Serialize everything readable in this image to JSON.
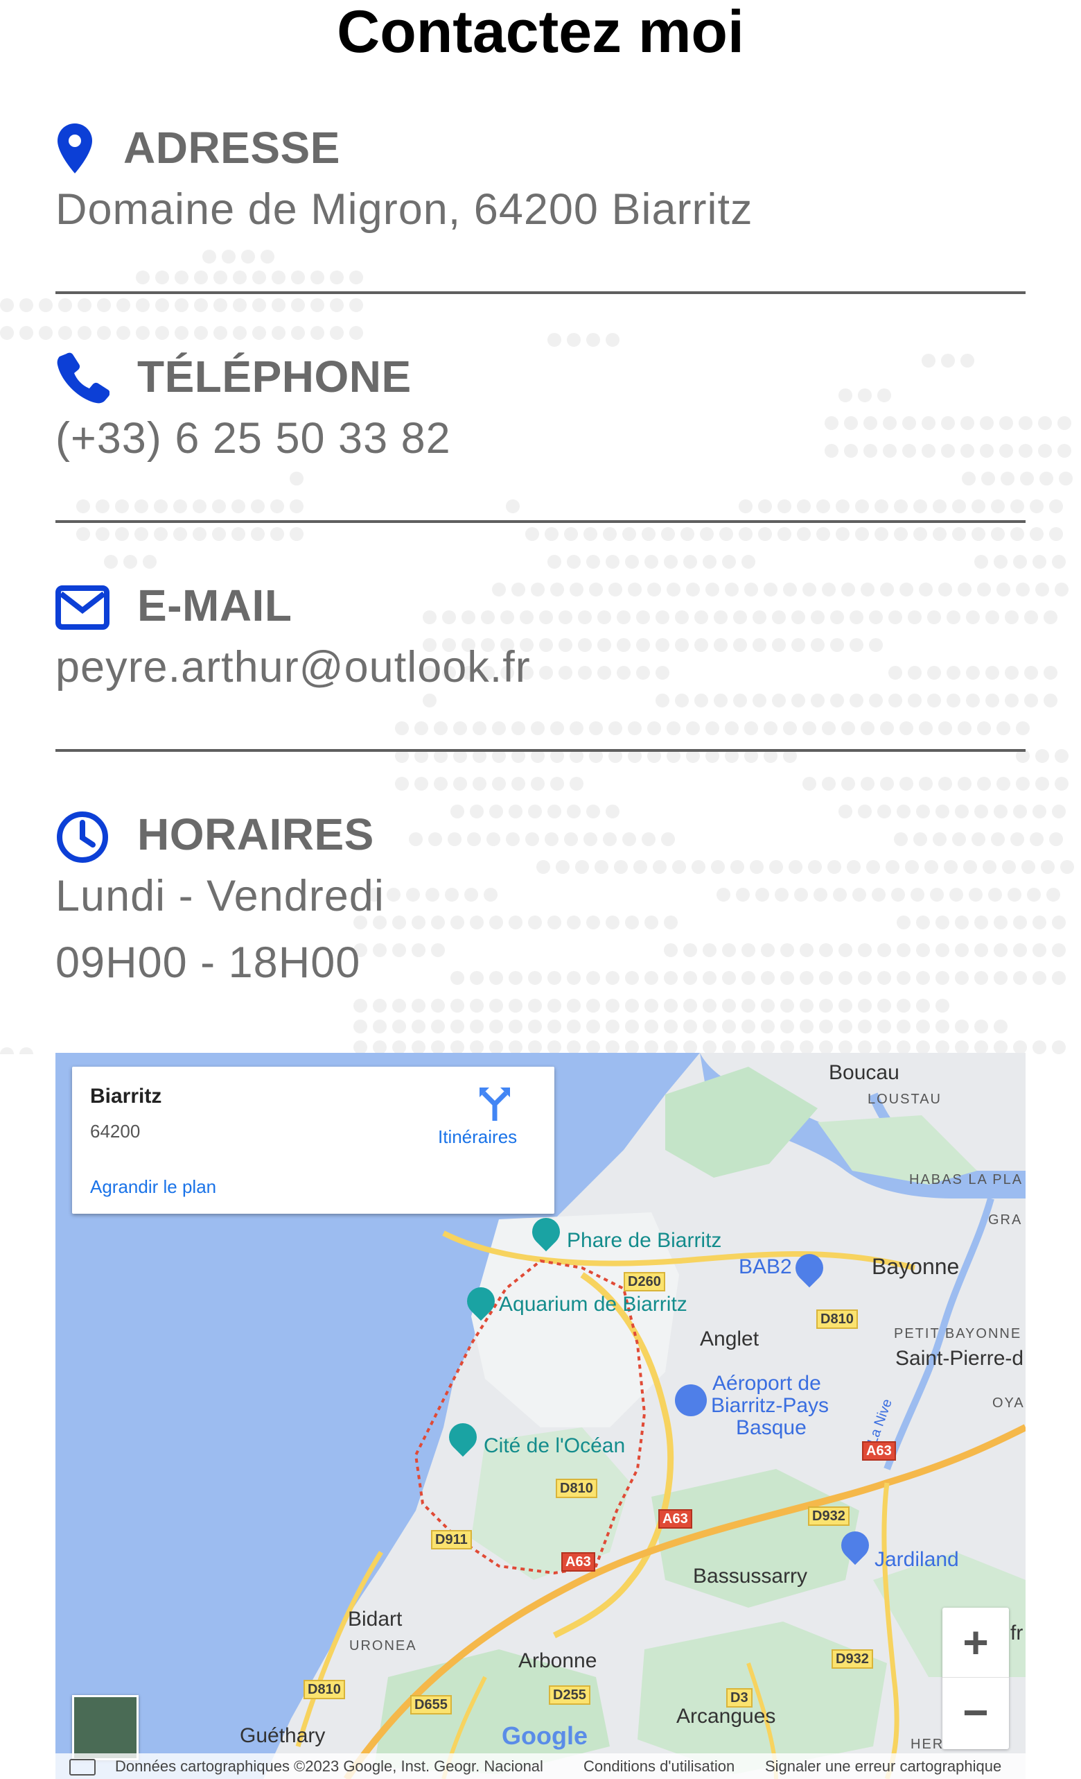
{
  "page": {
    "title": "Contactez moi"
  },
  "contact": {
    "address": {
      "label": "ADRESSE",
      "value": "Domaine de Migron, 64200 Biarritz",
      "icon": "map-pin-icon"
    },
    "phone": {
      "label": "TÉLÉPHONE",
      "value": "(+33) 6 25 50 33 82",
      "icon": "phone-icon"
    },
    "email": {
      "label": "E-MAIL",
      "value": "peyre.arthur@outlook.fr",
      "icon": "envelope-icon"
    },
    "hours": {
      "label": "HORAIRES",
      "days": "Lundi - Vendredi",
      "time": "09H00 - 18H00",
      "icon": "clock-icon"
    }
  },
  "colors": {
    "accent": "#0c3fd6",
    "text": "#6f6f6f",
    "map_water": "#9cbcf0",
    "map_land": "#e8eaed"
  },
  "map": {
    "card": {
      "place": "Biarritz",
      "postcode": "64200",
      "directions_label": "Itinéraires",
      "enlarge_label": "Agrandir le plan"
    },
    "places": [
      "Boucau",
      "LOUSTAU",
      "HABAS LA PLA",
      "GRA",
      "Bayonne",
      "PETIT BAYONNE",
      "Saint-Pierre-d",
      "OYA",
      "BAB2",
      "Anglet",
      "Phare de Biarritz",
      "Aquarium de Biarritz",
      "Aéroport de",
      "Biarritz-Pays",
      "Basque",
      "Cité de l'Océan",
      "Bassussarry",
      "Jardiland",
      "Bidart",
      "URONEA",
      "Arbonne",
      "Arcangues",
      "Guéthary",
      "HERAURITZ",
      "La Nive",
      "fr"
    ],
    "roads": [
      "D260",
      "D810",
      "A63",
      "D810",
      "A63",
      "D932",
      "D911",
      "A63",
      "D810",
      "D655",
      "D255",
      "D3",
      "D932"
    ],
    "attribution": {
      "data": "Données cartographiques ©2023 Google, Inst. Geogr. Nacional",
      "terms": "Conditions d'utilisation",
      "report": "Signaler une erreur cartographique"
    },
    "logo": "Google",
    "zoom_in": "+",
    "zoom_out": "−"
  }
}
